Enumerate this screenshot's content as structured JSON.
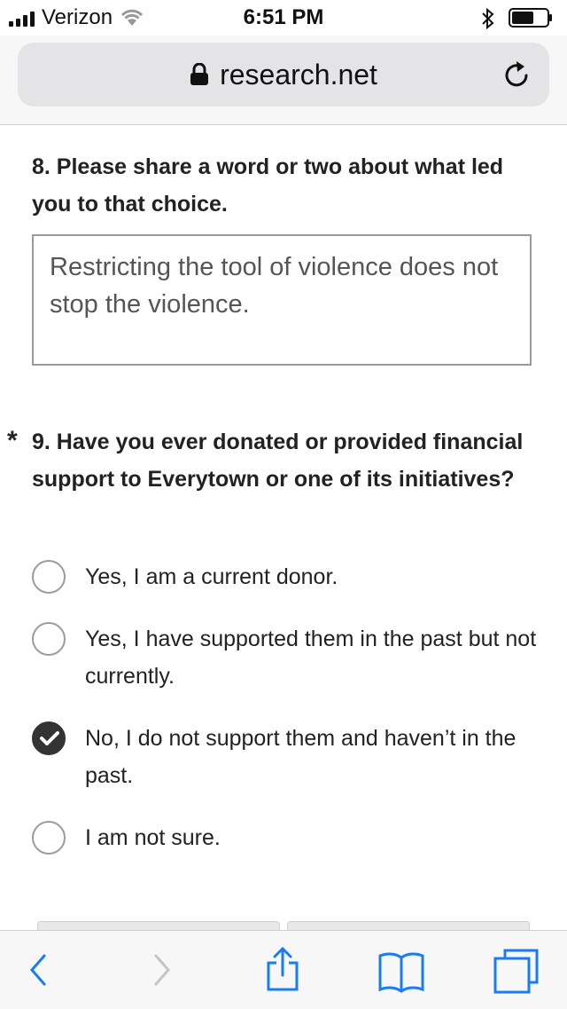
{
  "status_bar": {
    "carrier": "Verizon",
    "time": "6:51 PM"
  },
  "browser": {
    "url": "research.net"
  },
  "question8": {
    "title": "8. Please share a word or two about what led you to that choice.",
    "answer": "Restricting the tool of violence does not stop the violence."
  },
  "question9": {
    "required_mark": "*",
    "title": "9. Have you ever donated or provided financial support to Everytown or one of its initiatives?",
    "options": [
      {
        "label": "Yes, I am a current donor.",
        "selected": false
      },
      {
        "label": "Yes, I have supported them in the past but not currently.",
        "selected": false
      },
      {
        "label": "No, I do not support them and haven’t in the past.",
        "selected": true
      },
      {
        "label": "I am not sure.",
        "selected": false
      }
    ]
  },
  "toolbar": {
    "icons": [
      "back-icon",
      "forward-icon",
      "share-icon",
      "bookmarks-icon",
      "tabs-icon"
    ],
    "accent_color": "#1a7cf5"
  }
}
